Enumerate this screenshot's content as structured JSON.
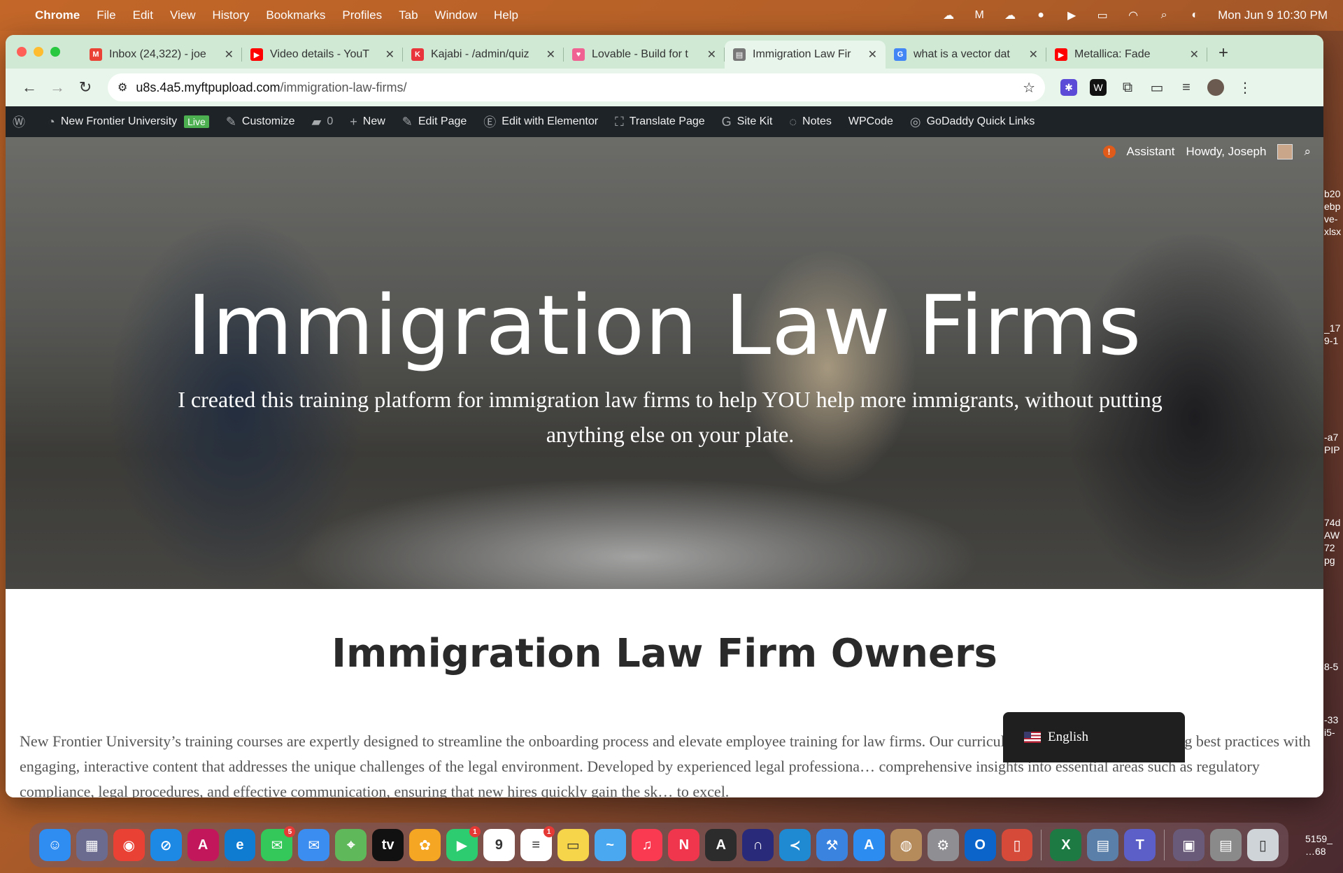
{
  "menubar": {
    "app": "Chrome",
    "items": [
      "File",
      "Edit",
      "View",
      "History",
      "Bookmarks",
      "Profiles",
      "Tab",
      "Window",
      "Help"
    ],
    "clock": "Mon Jun 9  10:30 PM"
  },
  "tabs": [
    {
      "title": "Inbox (24,322) - joe",
      "favicon": "M",
      "color": "#ea4335"
    },
    {
      "title": "Video details - YouT",
      "favicon": "▶",
      "color": "#ff0000"
    },
    {
      "title": "Kajabi - /admin/quiz",
      "favicon": "K",
      "color": "#e8343a"
    },
    {
      "title": "Lovable - Build for t",
      "favicon": "♥",
      "color": "#f06292"
    },
    {
      "title": "Immigration Law Fir",
      "favicon": "▤",
      "color": "#777777",
      "active": true
    },
    {
      "title": "what is a vector dat",
      "favicon": "G",
      "color": "#4285f4"
    },
    {
      "title": "Metallica: Fade",
      "favicon": "▶",
      "color": "#ff0000"
    }
  ],
  "toolbar": {
    "url_host": "u8s.4a5.myftpupload.com",
    "url_path": "/immigration-law-firms/"
  },
  "wpbar": {
    "site_name": "New Frontier University",
    "live_badge": "Live",
    "customize": "Customize",
    "comments_count": "0",
    "new": "New",
    "edit_page": "Edit Page",
    "edit_elementor": "Edit with Elementor",
    "translate": "Translate Page",
    "site_kit": "Site Kit",
    "notes": "Notes",
    "wpcode": "WPCode",
    "godaddy": "GoDaddy Quick Links",
    "assistant": "Assistant",
    "howdy": "Howdy, Joseph"
  },
  "hero": {
    "title": "Immigration Law Firms",
    "subtitle": "I created this training platform for immigration law firms to help YOU help more immigrants, without putting anything else on your plate."
  },
  "section": {
    "heading": "Immigration Law Firm Owners",
    "body": "New Frontier University’s training courses are expertly designed to streamline the onboarding process and elevate employee training for law firms. Our curriculum combines industry-leading best practices with engaging, interactive content that addresses the unique challenges of the legal environment. Developed by experienced legal professiona… comprehensive insights into essential areas such as regulatory compliance, legal procedures, and effective communication, ensuring that new hires quickly gain the sk… to excel."
  },
  "language_switcher": {
    "label": "English"
  },
  "desktop_side_labels": [
    "b20",
    "ebp",
    "ve-",
    "xlsx",
    "_17",
    "9-1",
    "-a7",
    "PIP",
    "74d",
    "AW",
    "72",
    "pg",
    "8-5",
    "-33",
    "i5-",
    "5159_",
    "…68"
  ],
  "dock_apps": [
    {
      "name": "finder",
      "label": "☺",
      "color": "#2f8cf0"
    },
    {
      "name": "launchpad",
      "label": "▦",
      "color": "#6b6b8f"
    },
    {
      "name": "chrome",
      "label": "◉",
      "color": "#e94235"
    },
    {
      "name": "safari",
      "label": "⊘",
      "color": "#1e88e5"
    },
    {
      "name": "affinity",
      "label": "A",
      "color": "#c2185b"
    },
    {
      "name": "edge",
      "label": "e",
      "color": "#0f7bd1"
    },
    {
      "name": "messages",
      "label": "✉",
      "color": "#34c759",
      "badge": "5"
    },
    {
      "name": "mail",
      "label": "✉",
      "color": "#3b8ef0"
    },
    {
      "name": "maps",
      "label": "⌖",
      "color": "#5fb85a"
    },
    {
      "name": "tv",
      "label": "tv",
      "color": "#111111"
    },
    {
      "name": "photos",
      "label": "✿",
      "color": "#f5a623"
    },
    {
      "name": "facetime",
      "label": "▶",
      "color": "#2ecc71",
      "badge": "1"
    },
    {
      "name": "calendar",
      "label": "9",
      "color": "#ffffff"
    },
    {
      "name": "reminders",
      "label": "≡",
      "color": "#ffffff",
      "badge": "1"
    },
    {
      "name": "notes",
      "label": "▭",
      "color": "#f7d54a"
    },
    {
      "name": "freeform",
      "label": "~",
      "color": "#4aa8f0"
    },
    {
      "name": "music",
      "label": "♫",
      "color": "#fa3a50"
    },
    {
      "name": "news",
      "label": "N",
      "color": "#f0364c"
    },
    {
      "name": "chatgpt",
      "label": "A",
      "color": "#2c2c2c"
    },
    {
      "name": "nord",
      "label": "∩",
      "color": "#2a2a7a"
    },
    {
      "name": "vscode",
      "label": "≺",
      "color": "#1f8ad2"
    },
    {
      "name": "xcode",
      "label": "⚒",
      "color": "#3a84e0"
    },
    {
      "name": "appstore",
      "label": "A",
      "color": "#2d8cf0"
    },
    {
      "name": "contacts",
      "label": "◍",
      "color": "#b58b5c"
    },
    {
      "name": "settings",
      "label": "⚙",
      "color": "#8e8e93"
    },
    {
      "name": "outlook",
      "label": "O",
      "color": "#0a64c9"
    },
    {
      "name": "iphone-mirroring",
      "label": "▯",
      "color": "#d64a3a"
    },
    {
      "name": "excel",
      "label": "X",
      "color": "#1d7a42"
    },
    {
      "name": "preview",
      "label": "▤",
      "color": "#5a7fa8"
    },
    {
      "name": "teams",
      "label": "T",
      "color": "#5b5fc7"
    },
    {
      "name": "stacks-1",
      "label": "▣",
      "color": "#6a5a7a"
    },
    {
      "name": "stacks-2",
      "label": "▤",
      "color": "#8a8a8a"
    },
    {
      "name": "trash",
      "label": "▯",
      "color": "#cfd4d8"
    }
  ]
}
